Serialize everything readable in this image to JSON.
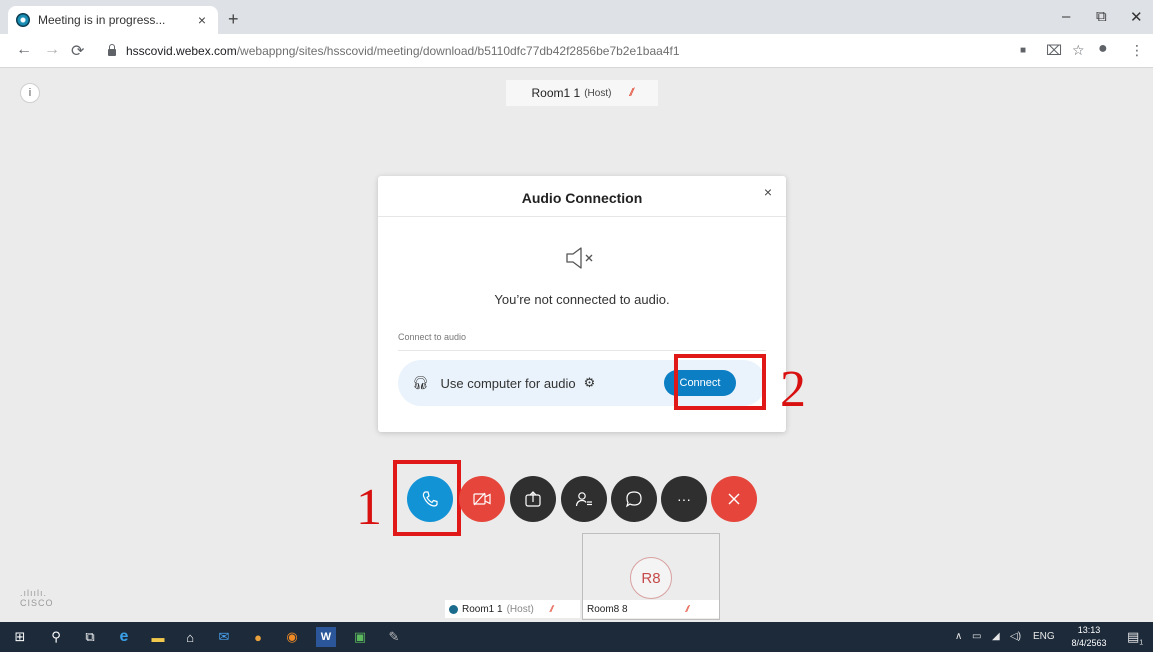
{
  "browser": {
    "tab_title": "Meeting is in progress...",
    "tab_close": "×",
    "new_tab": "+",
    "url_host": "hsscovid.webex.com",
    "url_path": "/webappng/sites/hsscovid/meeting/download/b5110dfc77db42f2856be7b2e1baa4f1",
    "window_controls": [
      "–",
      "⧉",
      "✕"
    ]
  },
  "meeting": {
    "info_icon": "i",
    "active_speaker": {
      "name": "Room1 1",
      "role": "(Host)"
    },
    "dialog": {
      "title": "Audio Connection",
      "close": "×",
      "message": "You’re not connected to audio.",
      "section_label": "Connect to audio",
      "option_label": "Use computer for audio",
      "connect_button": "Connect"
    },
    "annotations": {
      "one": "1",
      "two": "2"
    },
    "controls": [
      {
        "name": "audio-button",
        "icon": "phone-icon",
        "color": "#1293d6"
      },
      {
        "name": "video-button",
        "icon": "video-off-icon",
        "color": "#e5453a"
      },
      {
        "name": "share-button",
        "icon": "share-icon",
        "color": "#2f2f2f"
      },
      {
        "name": "participants-button",
        "icon": "participants-icon",
        "color": "#2f2f2f"
      },
      {
        "name": "chat-button",
        "icon": "chat-icon",
        "color": "#2f2f2f"
      },
      {
        "name": "more-button",
        "icon": "more-icon",
        "color": "#2f2f2f"
      },
      {
        "name": "leave-button",
        "icon": "close-icon",
        "color": "#e5453a"
      }
    ],
    "tiles": {
      "self": {
        "name": "Room1 1",
        "role": "(Host)"
      },
      "other": {
        "name": "Room8 8",
        "initials": "R8"
      }
    },
    "brand": "CISCO"
  },
  "taskbar": {
    "language": "ENG",
    "time": "13:13",
    "date": "8/4/2563",
    "notifications": "1"
  }
}
